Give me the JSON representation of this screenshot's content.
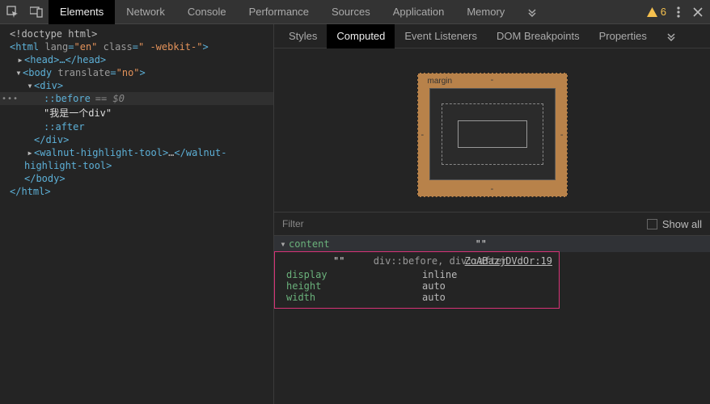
{
  "toolbar": {
    "tabs": [
      "Elements",
      "Network",
      "Console",
      "Performance",
      "Sources",
      "Application",
      "Memory"
    ],
    "active_tab": "Elements",
    "warning_count": "6"
  },
  "dom": {
    "doctype": "<!doctype html>",
    "html_open_prefix": "<html ",
    "html_lang_attr": "lang",
    "html_lang_val": "\"en\"",
    "html_class_attr": "class",
    "html_class_val": "\" -webkit-\"",
    "html_open_suffix": ">",
    "head": "<head>…</head>",
    "body_open_prefix": "<body ",
    "body_attr": "translate",
    "body_val": "\"no\"",
    "body_open_suffix": ">",
    "div_open": "<div>",
    "before": "::before",
    "sel_badge": "== $0",
    "text_node": "\"我是一个div\"",
    "after": "::after",
    "div_close": "</div>",
    "walnut_open": "<walnut-highlight-tool>",
    "walnut_ell": "…",
    "walnut_close": "</walnut-highlight-tool>",
    "body_close": "</body>",
    "html_close": "</html>",
    "gutter": "•••"
  },
  "side": {
    "tabs": [
      "Styles",
      "Computed",
      "Event Listeners",
      "DOM Breakpoints",
      "Properties"
    ],
    "active_tab": "Computed",
    "box_model": {
      "label": "margin",
      "top": "-",
      "right": "-",
      "bottom": "-",
      "left": "-"
    },
    "filter_placeholder": "Filter",
    "show_all_label": "Show all",
    "header_prop": "content",
    "header_val": "\"\"",
    "rule_value": "\"\"",
    "rule_selector": "div::before, div::after",
    "source_link": "ZoABazjDVdOr:19",
    "rows": [
      {
        "name": "display",
        "value": "inline"
      },
      {
        "name": "height",
        "value": "auto"
      },
      {
        "name": "width",
        "value": "auto"
      }
    ]
  }
}
